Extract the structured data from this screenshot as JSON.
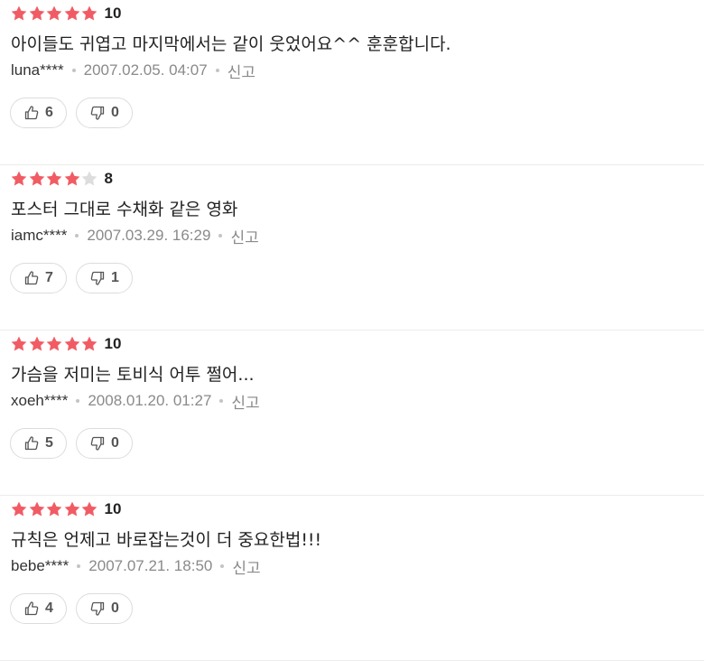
{
  "colors": {
    "star_filled": "#f15c64",
    "star_empty": "#dddddd",
    "divider": "#ececec",
    "meta_text": "#8a8a8a"
  },
  "reviews": [
    {
      "rating": 5,
      "score": "10",
      "comment": "아이들도 귀엽고 마지막에서는 같이 웃었어요^^ 훈훈합니다.",
      "author": "luna****",
      "date": "2007.02.05. 04:07",
      "report_label": "신고",
      "like_count": "6",
      "dislike_count": "0"
    },
    {
      "rating": 4,
      "score": "8",
      "comment": "포스터 그대로 수채화 같은 영화",
      "author": "iamc****",
      "date": "2007.03.29. 16:29",
      "report_label": "신고",
      "like_count": "7",
      "dislike_count": "1"
    },
    {
      "rating": 5,
      "score": "10",
      "comment": "가슴을 저미는 토비식 어투 쩔어...",
      "author": "xoeh****",
      "date": "2008.01.20. 01:27",
      "report_label": "신고",
      "like_count": "5",
      "dislike_count": "0"
    },
    {
      "rating": 5,
      "score": "10",
      "comment": "규칙은 언제고 바로잡는것이 더 중요한법!!!",
      "author": "bebe****",
      "date": "2007.07.21. 18:50",
      "report_label": "신고",
      "like_count": "4",
      "dislike_count": "0"
    }
  ],
  "icons": {
    "like": "thumbs-up-icon",
    "dislike": "thumbs-down-icon",
    "star": "star-icon"
  }
}
